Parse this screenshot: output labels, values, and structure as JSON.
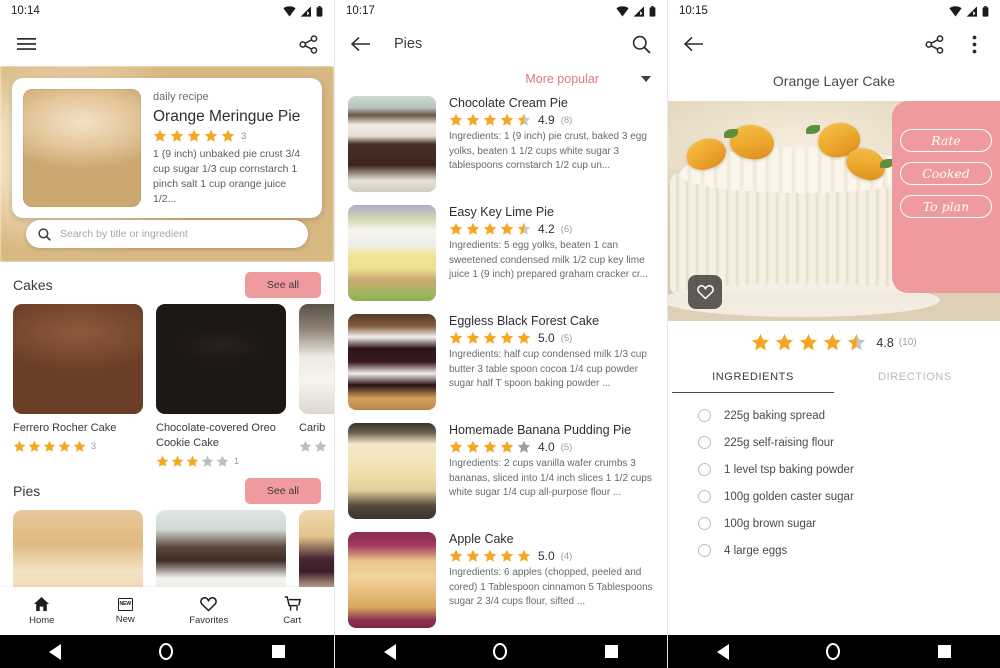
{
  "accent_pink": "#ef9a9e",
  "accent_star": "#f5a623",
  "screen1": {
    "status_time": "10:14",
    "appbar": {
      "menu_icon": "hamburger-menu-icon",
      "share_icon": "share-icon"
    },
    "hero": {
      "kicker": "daily recipe",
      "title": "Orange Meringue Pie",
      "stars": 5,
      "rating_count": "3",
      "description": "1 (9 inch) unbaked pie crust 3/4 cup sugar 1/3 cup cornstarch 1 pinch salt 1 cup orange juice 1/2..."
    },
    "search": {
      "placeholder": "Search by title or ingredient",
      "value": "",
      "icon": "search-icon"
    },
    "sections": [
      {
        "title": "Cakes",
        "see_all": "See all",
        "cards": [
          {
            "name": "Ferrero Rocher Cake",
            "stars": 5,
            "count": "3",
            "thumb_class": "t-ferrero"
          },
          {
            "name": "Chocolate-covered Oreo Cookie Cake",
            "stars": 3,
            "count": "1",
            "thumb_class": "t-oreo"
          },
          {
            "name": "Carib",
            "stars": 0,
            "count": "",
            "thumb_class": "t-carib"
          }
        ]
      },
      {
        "title": "Pies",
        "see_all": "See all",
        "cards": [
          {
            "name": "",
            "stars": 0,
            "count": "",
            "thumb_class": "t-pie1"
          },
          {
            "name": "",
            "stars": 0,
            "count": "",
            "thumb_class": "t-pie2"
          },
          {
            "name": "",
            "stars": 0,
            "count": "",
            "thumb_class": "t-pie3"
          }
        ]
      }
    ],
    "bottom_nav": [
      {
        "label": "Home",
        "icon": "home-icon",
        "active": true
      },
      {
        "label": "New",
        "icon": "new-badge-icon",
        "active": false
      },
      {
        "label": "Favorites",
        "icon": "heart-icon",
        "active": false
      },
      {
        "label": "Cart",
        "icon": "cart-icon",
        "active": false
      }
    ]
  },
  "screen2": {
    "status_time": "10:17",
    "appbar": {
      "back_icon": "back-arrow-icon",
      "title": "Pies",
      "search_icon": "search-icon"
    },
    "sort": {
      "label": "More popular",
      "caret_icon": "chevron-down-icon"
    },
    "items": [
      {
        "title": "Chocolate Cream Pie",
        "stars": 4.5,
        "score": "4.9",
        "count": "(8)",
        "desc": "Ingredients: 1 (9 inch) pie crust, baked 3 egg yolks, beaten 1 1/2 cups white sugar 3 tablespoons cornstarch 1/2 cup un...",
        "thumb_class": "t-ccp"
      },
      {
        "title": "Easy Key Lime Pie",
        "stars": 4.5,
        "score": "4.2",
        "count": "(6)",
        "desc": "Ingredients: 5 egg yolks, beaten 1 can sweetened condensed milk 1/2 cup key lime juice 1 (9 inch) prepared graham cracker cr...",
        "thumb_class": "t-klp"
      },
      {
        "title": "Eggless Black Forest Cake",
        "stars": 5,
        "score": "5.0",
        "count": "(5)",
        "desc": "Ingredients: half cup condensed milk 1/3 cup butter 3 table spoon cocoa 1/4 cup powder sugar half T spoon baking powder ...",
        "thumb_class": "t-ebf"
      },
      {
        "title": "Homemade Banana Pudding Pie",
        "stars": 4,
        "score": "4.0",
        "count": "(5)",
        "desc": "Ingredients: 2 cups vanilla wafer crumbs 3 bananas, sliced into 1/4 inch slices 1 1/2 cups white sugar 1/4 cup all-purpose flour ...",
        "thumb_class": "t-hbp"
      },
      {
        "title": "Apple Cake",
        "stars": 5,
        "score": "5.0",
        "count": "(4)",
        "desc": "Ingredients: 6 apples (chopped, peeled and cored) 1 Tablespoon cinnamon 5 Tablespoons sugar 2 3/4 cups flour, sifted ...",
        "thumb_class": "t-apple"
      }
    ]
  },
  "screen3": {
    "status_time": "10:15",
    "appbar": {
      "back_icon": "back-arrow-icon",
      "share_icon": "share-icon",
      "overflow_icon": "more-vertical-icon"
    },
    "recipe_title": "Orange Layer Cake",
    "action_buttons": [
      {
        "label": "Rate",
        "name": "rate-button"
      },
      {
        "label": "Cooked",
        "name": "cooked-button"
      },
      {
        "label": "To plan",
        "name": "to-plan-button"
      }
    ],
    "favorite_icon": "heart-icon",
    "rating": {
      "stars": 4.5,
      "score": "4.8",
      "count": "(10)"
    },
    "tabs": [
      {
        "label": "INGREDIENTS",
        "active": true
      },
      {
        "label": "DIRECTIONS",
        "active": false
      }
    ],
    "ingredients": [
      "225g baking spread",
      "225g self-raising flour",
      "1 level tsp baking powder",
      "100g golden caster sugar",
      "100g brown sugar",
      "4 large eggs"
    ]
  },
  "system_nav": {
    "back": "system-back-icon",
    "home": "system-home-icon",
    "recents": "system-recents-icon"
  }
}
